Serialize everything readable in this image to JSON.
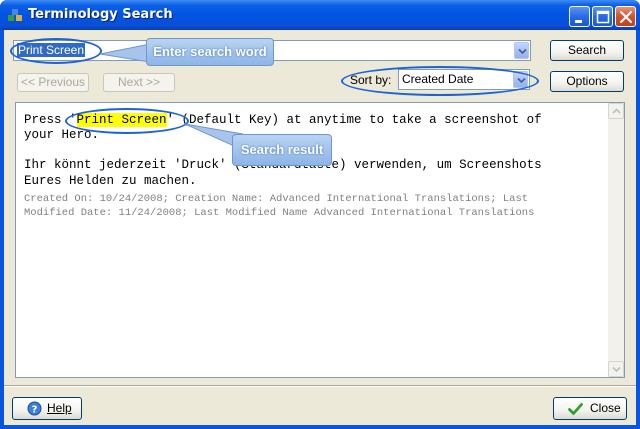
{
  "window": {
    "title": "Terminology Search"
  },
  "search": {
    "value": "Print Screen",
    "button_label": "Search"
  },
  "nav": {
    "previous_label": "<< Previous",
    "next_label": "Next >>"
  },
  "sort": {
    "label": "Sort by:",
    "value": "Created Date",
    "options_label": "Options"
  },
  "result": {
    "line1_prefix": "Press '",
    "line1_highlight": "Print Screen",
    "line1_suffix": "' (Default Key) at anytime to take a screenshot of",
    "line2": "your Hero.",
    "line3": "Ihr könnt jederzeit 'Druck' (Standardtaste) verwenden, um Screenshots",
    "line4": "Eures Helden zu machen.",
    "meta_line1": "Created On: 10/24/2008; Creation Name: Advanced International Translations; Last",
    "meta_line2": "Modified Date: 11/24/2008; Last Modified Name Advanced International Translations"
  },
  "callouts": {
    "search_word": "Enter search word",
    "search_result": "Search result"
  },
  "footer": {
    "help_label": "Help",
    "close_label": "Close"
  },
  "icons": {
    "app": "app-icon",
    "help": "help-icon",
    "close": "checkmark-icon"
  },
  "colors": {
    "titlebar": "#0054e3",
    "highlight": "#ffff00",
    "callout": "#8db5e6",
    "ellipse": "#1e63d6"
  }
}
